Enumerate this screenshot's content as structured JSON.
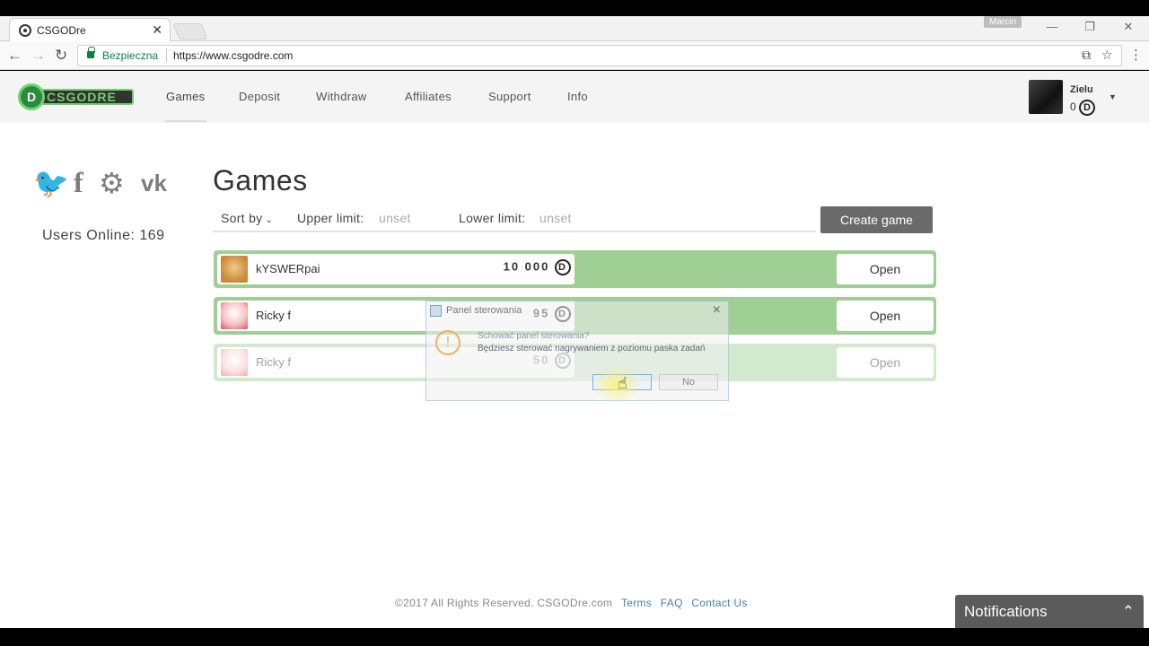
{
  "browser": {
    "tab_title": "CSGODre",
    "tab_close": "✕",
    "window_user": "Marcin",
    "minimize": "—",
    "restore": "❐",
    "close": "✕",
    "secure_label": "Bezpieczna",
    "url": "https://www.csgodre.com"
  },
  "site": {
    "nav": [
      "Games",
      "Deposit",
      "Withdraw",
      "Affiliates",
      "Support",
      "Info"
    ],
    "user": {
      "name": "Zielu",
      "balance": "0",
      "coin": "D"
    },
    "users_online": "Users Online: 169"
  },
  "games": {
    "title": "Games",
    "sort_by": "Sort by",
    "upper_label": "Upper limit:",
    "upper_value": "unset",
    "lower_label": "Lower limit:",
    "lower_value": "unset",
    "create_label": "Create game",
    "open_label": "Open",
    "rows": [
      {
        "name": "kYSWERpai",
        "amount": "10 000"
      },
      {
        "name": "Ricky f",
        "amount": "95"
      },
      {
        "name": "Ricky f",
        "amount": "50"
      }
    ]
  },
  "dialog": {
    "title": "Panel sterowania",
    "question": "Schować panel sterowania?",
    "message": "Będziesz sterować nagrywaniem z poziomu paska zadań",
    "no_label": "No"
  },
  "footer": {
    "copyright": "©2017 All Rights Reserved. CSGODre.com",
    "terms": "Terms",
    "faq": "FAQ",
    "contact": "Contact Us"
  },
  "notifications_label": "Notifications"
}
